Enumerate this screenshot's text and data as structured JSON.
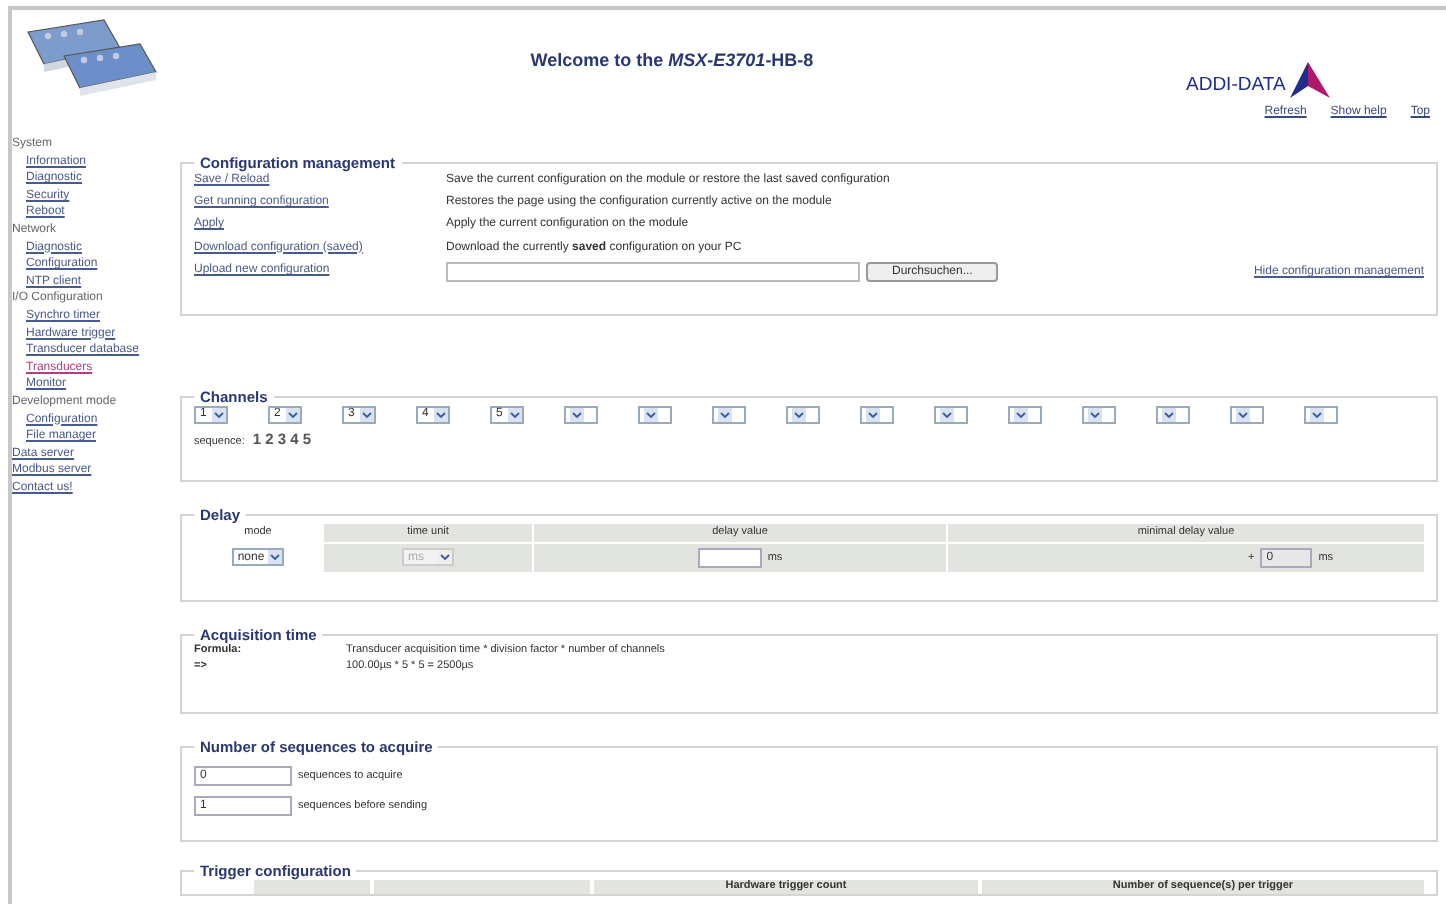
{
  "header": {
    "title": "Welcome to the **MSX-E3701**-HB-8",
    "brand": "ADDI-DATA",
    "links": [
      "Refresh",
      "Show help",
      "Top"
    ]
  },
  "sidebar": {
    "items": [
      {
        "label": "System",
        "children": [
          {
            "label": "Information",
            "selected": false
          },
          {
            "label": "Diagnostic",
            "selected": false
          },
          {
            "label": "Security",
            "selected": false
          },
          {
            "label": "Reboot",
            "selected": false
          }
        ]
      },
      {
        "label": "Network",
        "children": [
          {
            "label": "Diagnostic",
            "selected": false
          },
          {
            "label": "Configuration",
            "selected": false
          },
          {
            "label": "NTP client",
            "selected": false
          }
        ]
      },
      {
        "label": "I/O Configuration",
        "children": [
          {
            "label": "Synchro timer",
            "selected": false
          },
          {
            "label": "Hardware trigger",
            "selected": false
          },
          {
            "label": "Transducer database",
            "selected": false
          },
          {
            "label": "Transducers",
            "selected": true
          },
          {
            "label": "Monitor",
            "selected": false
          }
        ]
      },
      {
        "label": "Development mode",
        "children": [
          {
            "label": "Configuration",
            "selected": false
          },
          {
            "label": "File manager",
            "selected": false
          }
        ]
      },
      {
        "label": "Data server",
        "selected": false
      },
      {
        "label": "Modbus server",
        "selected": false
      },
      {
        "label": "Contact us!",
        "selected": false
      }
    ]
  },
  "configuration_management": {
    "title": "Configuration management",
    "rows": [
      {
        "link": "Save / Reload",
        "description": "Save the current configuration on the module or restore the last saved configuration"
      },
      {
        "link": "Get running configuration",
        "description": "Restores the page using the configuration currently active on the module"
      },
      {
        "link": "Apply",
        "description": "Apply the current configuration on the module"
      },
      {
        "link": "Download configuration (saved)",
        "description": "Download the currently **saved** configuration on your PC"
      },
      {
        "link": "Upload new configuration",
        "kind": "upload",
        "button": "Durchsuchen..."
      }
    ],
    "hide_link": "Hide configuration management"
  },
  "channels": {
    "title": "Channels",
    "selects": [
      {
        "kind": "numbered",
        "value": "1"
      },
      {
        "kind": "numbered",
        "value": "2"
      },
      {
        "kind": "numbered",
        "value": "3"
      },
      {
        "kind": "numbered",
        "value": "4"
      },
      {
        "kind": "numbered",
        "value": "5"
      },
      {
        "kind": "blank"
      },
      {
        "kind": "blank"
      },
      {
        "kind": "blank"
      },
      {
        "kind": "blank"
      },
      {
        "kind": "blank"
      },
      {
        "kind": "blank"
      },
      {
        "kind": "blank"
      },
      {
        "kind": "blank"
      },
      {
        "kind": "blank"
      },
      {
        "kind": "blank"
      },
      {
        "kind": "blank"
      }
    ],
    "sequence_label": "sequence:",
    "sequence": "1 2 3 4 5"
  },
  "delay": {
    "title": "Delay",
    "columns": [
      "mode",
      "time unit",
      "delay value",
      "minimal delay value"
    ],
    "mode": "none",
    "time_unit": {
      "value": "ms",
      "disabled": true
    },
    "delay_unit": "ms",
    "minimal_prefix": "+",
    "minimal_value": "0",
    "minimal_unit": "ms"
  },
  "acquisition_time": {
    "title": "Acquisition time",
    "rows": [
      {
        "label": "Formula:",
        "text": "Transducer acquisition time * division factor * number of channels"
      },
      {
        "label": "=>",
        "text": "100.00µs * 5 * 5 = 2500µs"
      }
    ]
  },
  "sequences": {
    "title": "Number of sequences to acquire",
    "rows": [
      {
        "value": "0",
        "label": "sequences to acquire"
      },
      {
        "value": "1",
        "label": "sequences before sending"
      }
    ]
  },
  "trigger_configuration": {
    "title": "Trigger configuration",
    "columns": [
      "Hardware trigger count",
      "Number of sequence(s) per trigger"
    ]
  }
}
